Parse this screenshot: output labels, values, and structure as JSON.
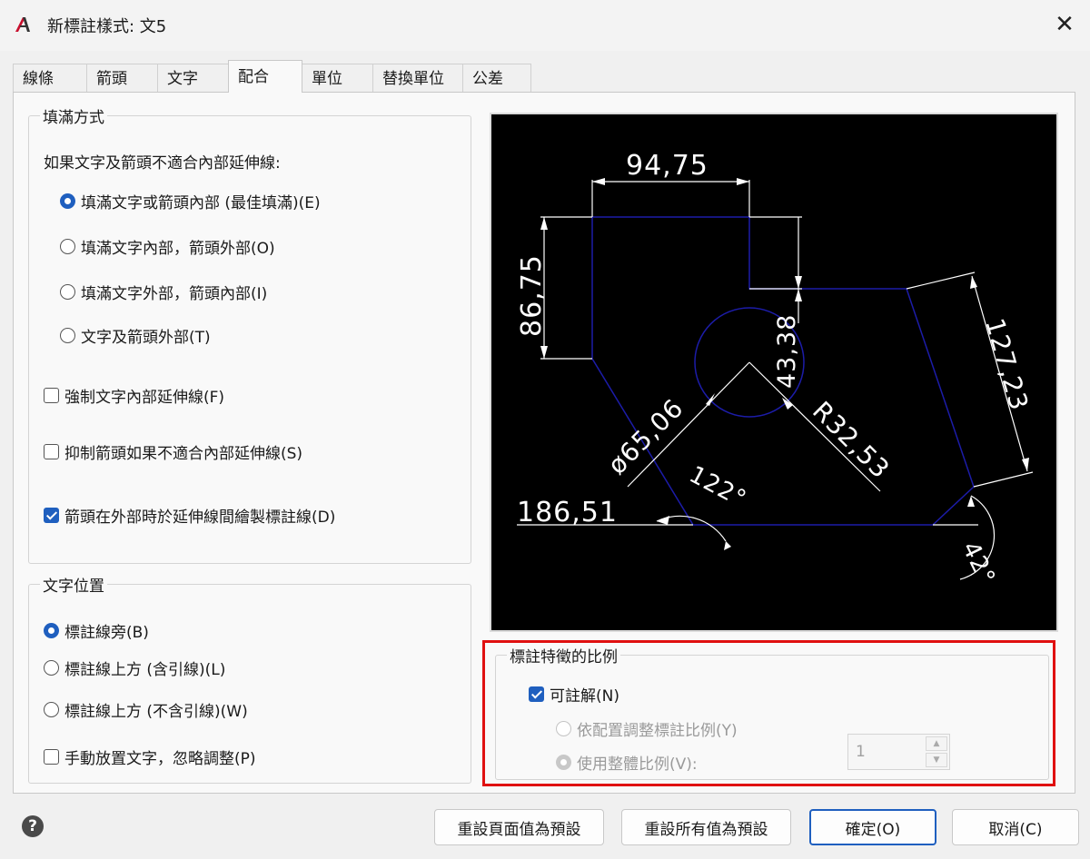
{
  "window": {
    "title": "新標註樣式: 文5",
    "app_icon": "autocad-icon",
    "close_icon": "close-icon"
  },
  "tabs": [
    {
      "label": "線條"
    },
    {
      "label": "箭頭"
    },
    {
      "label": "文字"
    },
    {
      "label": "配合",
      "active": true
    },
    {
      "label": "單位"
    },
    {
      "label": "替換單位"
    },
    {
      "label": "公差"
    }
  ],
  "fit_options": {
    "title": "填滿方式",
    "prompt": "如果文字及箭頭不適合內部延伸線:",
    "radios": [
      {
        "label": "填滿文字或箭頭內部 (最佳填滿)(E)",
        "selected": true
      },
      {
        "label": "填滿文字內部，箭頭外部(O)",
        "selected": false
      },
      {
        "label": "填滿文字外部，箭頭內部(I)",
        "selected": false
      },
      {
        "label": "文字及箭頭外部(T)",
        "selected": false
      }
    ],
    "checks": [
      {
        "label": "強制文字內部延伸線(F)",
        "checked": false
      },
      {
        "label": "抑制箭頭如果不適合內部延伸線(S)",
        "checked": false
      },
      {
        "label": "箭頭在外部時於延伸線間繪製標註線(D)",
        "checked": true
      }
    ]
  },
  "text_placement": {
    "title": "文字位置",
    "radios": [
      {
        "label": "標註線旁(B)",
        "selected": true
      },
      {
        "label": "標註線上方 (含引線)(L)",
        "selected": false
      },
      {
        "label": "標註線上方 (不含引線)(W)",
        "selected": false
      }
    ],
    "manual": {
      "label": "手動放置文字，忽略調整(P)",
      "checked": false
    }
  },
  "preview": {
    "dims": [
      "94,75",
      "86,75",
      "43,38",
      "127,23",
      "ø65,06",
      "R32,53",
      "122°",
      "186,51",
      "42°"
    ]
  },
  "scale": {
    "title": "標註特徵的比例",
    "annotative": {
      "label": "可註解(N)",
      "checked": true
    },
    "layout_scale": {
      "label": "依配置調整標註比例(Y)",
      "selected": false,
      "disabled": true
    },
    "overall_scale": {
      "label": "使用整體比例(V):",
      "selected": true,
      "disabled": true
    },
    "value": "1"
  },
  "footer": {
    "help_icon": "help-icon",
    "reset_page": "重設頁面值為預設",
    "reset_all": "重設所有值為預設",
    "ok": "確定(O)",
    "cancel": "取消(C)"
  },
  "colors": {
    "accent": "#1f5fbf",
    "highlight": "#e01010",
    "preview_bg": "#000000",
    "geometry": "#1c1ca8"
  }
}
